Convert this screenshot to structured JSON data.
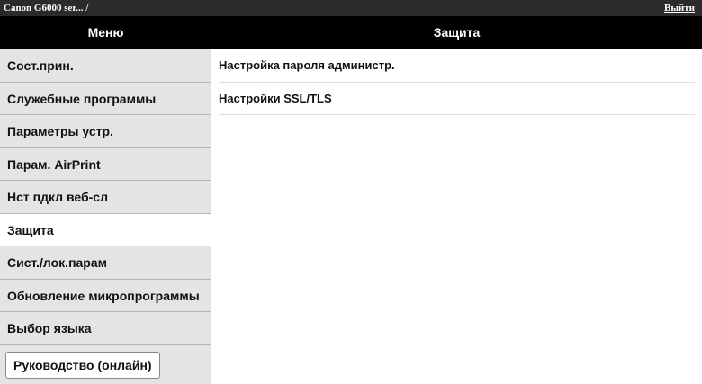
{
  "topbar": {
    "device_title": "Canon G6000 ser... /",
    "logout_label": "Выйти"
  },
  "header": {
    "menu_title": "Меню",
    "page_title": "Защита"
  },
  "sidebar": {
    "items": [
      {
        "label": "Сост.прин.",
        "active": false
      },
      {
        "label": "Служебные программы",
        "active": false
      },
      {
        "label": "Параметры устр.",
        "active": false
      },
      {
        "label": "Парам. AirPrint",
        "active": false
      },
      {
        "label": "Нст пдкл веб-сл",
        "active": false
      },
      {
        "label": "Защита",
        "active": true
      },
      {
        "label": "Сист./лок.парам",
        "active": false
      },
      {
        "label": "Обновление микропрограммы",
        "active": false
      },
      {
        "label": "Выбор языка",
        "active": false
      }
    ],
    "manual_button_label": "Руководство (онлайн)"
  },
  "content": {
    "rows": [
      {
        "label": "Настройка пароля администр."
      },
      {
        "label": "Настройки SSL/TLS"
      }
    ]
  },
  "colors": {
    "topbar_bg": "#2b2b2b",
    "header_bg": "#000000",
    "sidebar_bg": "#e4e4e4",
    "active_item_bg": "#ffffff"
  }
}
